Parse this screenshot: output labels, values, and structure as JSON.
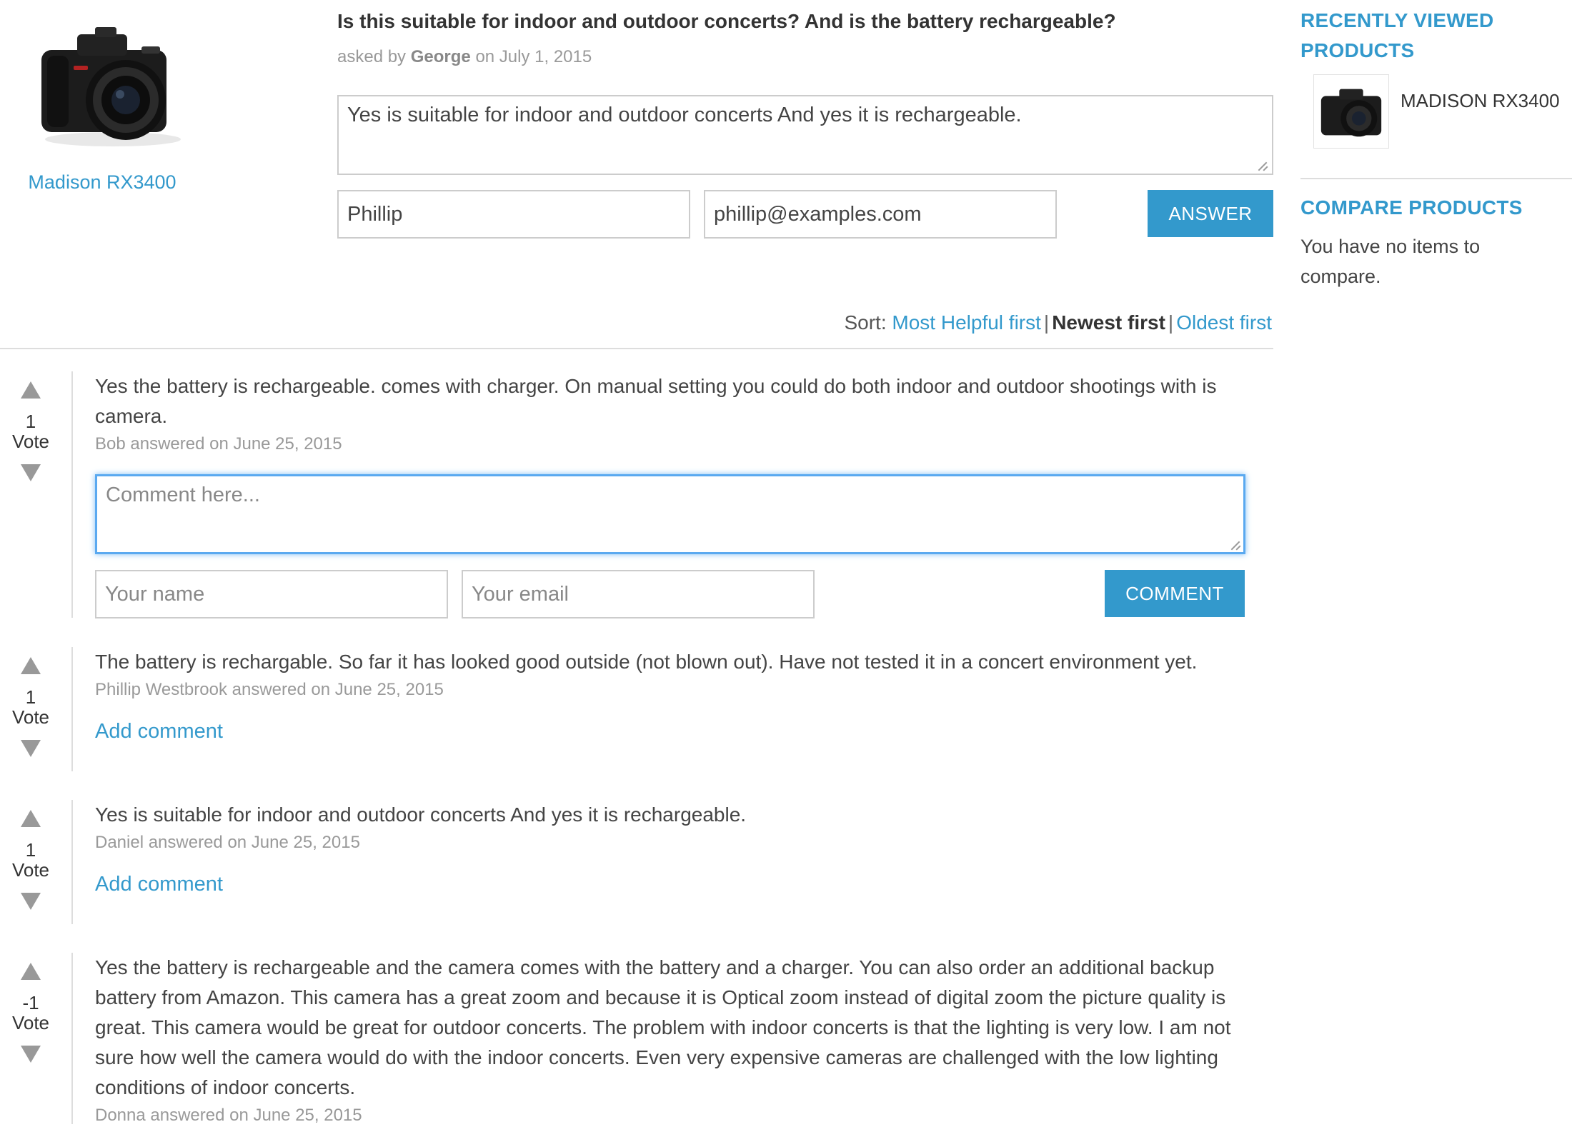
{
  "product": {
    "name": "Madison RX3400"
  },
  "question": {
    "title": "Is this suitable for indoor and outdoor concerts? And is the battery rechargeable?",
    "asked_prefix": "asked by",
    "asked_by": "George",
    "asked_on": "on July 1, 2015"
  },
  "answer_form": {
    "text_value": "Yes is suitable for indoor and outdoor concerts And yes it is rechargeable.",
    "name_value": "Phillip",
    "email_value": "phillip@examples.com",
    "submit_label": "ANSWER"
  },
  "sort": {
    "label": "Sort:",
    "options": [
      "Most Helpful first",
      "Newest first",
      "Oldest first"
    ],
    "active": "Newest first",
    "separator": "|"
  },
  "answers": [
    {
      "votes": "1",
      "vote_label": "Vote",
      "text": "Yes the battery is rechargeable. comes with charger. On manual setting you could do both indoor and outdoor shootings with is camera.",
      "meta": "Bob answered on June 25, 2015",
      "comment_form": {
        "placeholder": "Comment here...",
        "name_placeholder": "Your name",
        "email_placeholder": "Your email",
        "submit_label": "COMMENT"
      }
    },
    {
      "votes": "1",
      "vote_label": "Vote",
      "text": "The battery is rechargable. So far it has looked good outside (not blown out). Have not tested it in a concert environment yet.",
      "meta": "Phillip Westbrook answered on June 25, 2015",
      "add_comment": "Add comment"
    },
    {
      "votes": "1",
      "vote_label": "Vote",
      "text": "Yes is suitable for indoor and outdoor concerts And yes it is rechargeable.",
      "meta": "Daniel answered on June 25, 2015",
      "add_comment": "Add comment"
    },
    {
      "votes": "-1",
      "vote_label": "Vote",
      "text": "Yes the battery is rechargeable and the camera comes with the battery and a charger. You can also order an additional backup battery from Amazon. This camera has a great zoom and because it is Optical zoom instead of digital zoom the picture quality is great. This camera would be great for outdoor concerts. The problem with indoor concerts is that the lighting is very low. I am not sure how well the camera would do with the indoor concerts. Even very expensive cameras are challenged with the low lighting conditions of indoor concerts.",
      "meta": "Donna answered on June 25, 2015"
    }
  ],
  "sidebar": {
    "recently_viewed_title": "RECENTLY VIEWED PRODUCTS",
    "recently_viewed_item": "MADISON RX3400",
    "compare_title": "COMPARE PRODUCTS",
    "compare_text": "You have no items to compare."
  },
  "colors": {
    "accent": "#3399cc",
    "muted": "#999999",
    "text": "#444444",
    "divider": "#dddddd"
  }
}
